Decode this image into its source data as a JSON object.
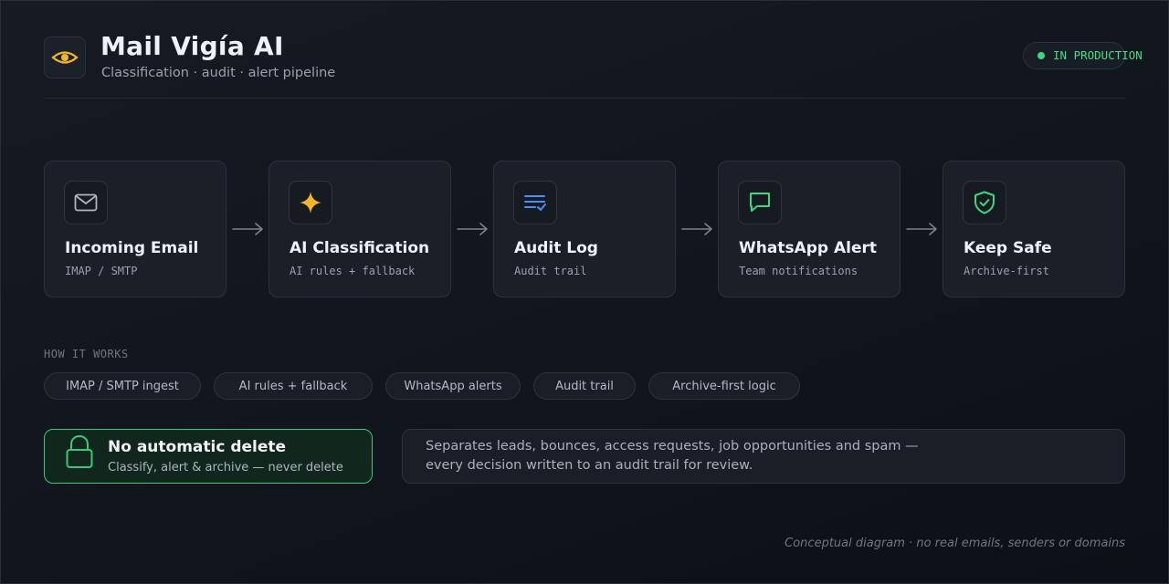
{
  "header": {
    "title": "Mail Vigía AI",
    "subtitle": "Classification · audit · alert pipeline",
    "logo_icon": "eye-icon",
    "status": {
      "label": "IN PRODUCTION",
      "color": "#3ed67f"
    }
  },
  "pipeline": [
    {
      "title": "Incoming Email",
      "subtitle": "IMAP / SMTP",
      "icon": "mail-icon",
      "color": "#aeb5bf"
    },
    {
      "title": "AI Classification",
      "subtitle": "AI rules + fallback",
      "icon": "sparkle-icon",
      "color": "#f2b629"
    },
    {
      "title": "Audit Log",
      "subtitle": "Audit trail",
      "icon": "list-check-icon",
      "color": "#4f8ff7"
    },
    {
      "title": "WhatsApp Alert",
      "subtitle": "Team notifications",
      "icon": "chat-bubble-icon",
      "color": "#3ed67f"
    },
    {
      "title": "Keep Safe",
      "subtitle": "Archive-first",
      "icon": "shield-check-icon",
      "color": "#3ed67f"
    }
  ],
  "how_it_works": {
    "label": "HOW IT WORKS",
    "chips": [
      "IMAP / SMTP ingest",
      "AI rules + fallback",
      "WhatsApp alerts",
      "Audit trail",
      "Archive-first logic"
    ]
  },
  "safety": {
    "title": "No automatic delete",
    "subtitle": "Classify, alert & archive — never delete",
    "icon": "lock-icon",
    "accent": "#3bc878"
  },
  "description": {
    "line1": "Separates leads, bounces, access requests, job opportunities and spam —",
    "line2": "every decision written to an audit trail for review."
  },
  "footnote": "Conceptual diagram · no real emails, senders or domains"
}
